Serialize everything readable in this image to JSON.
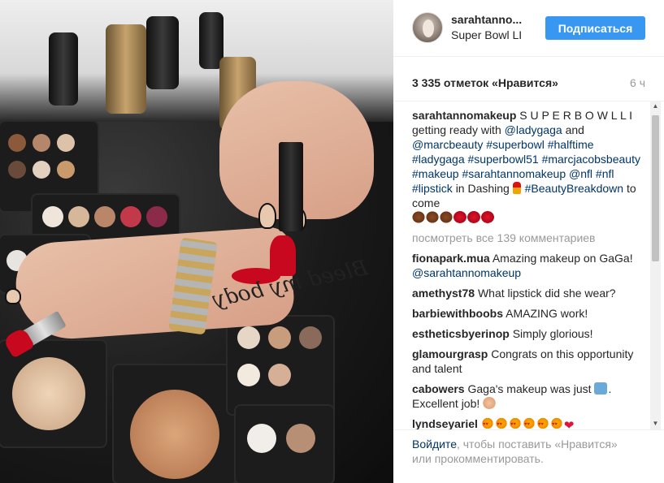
{
  "post": {
    "username": "sarahtanno...",
    "location": "Super Bowl LI",
    "follow_label": "Подписаться",
    "likes": "3 335 отметок «Нравится»",
    "time_ago": "6 ч"
  },
  "caption": {
    "user": "sarahtannomakeup",
    "text_1": "S U P E R B O W L L I getting ready with",
    "mention_1": "@ladygaga",
    "text_2": "and",
    "tags": "@marcbeauty #superbowl #halftime #ladygaga #superbowl51 #marcjacobsbeauty #makeup #sarahtannomakeup @nfl #nfl #lipstick",
    "text_3": "in Dashing",
    "tag_beauty": "#BeautyBreakdown",
    "text_4": "to come"
  },
  "view_all": "посмотреть все 139 комментариев",
  "comments": [
    {
      "user": "fionapark.mua",
      "text": "Amazing makeup on GaGa!",
      "mention": "@sarahtannomakeup"
    },
    {
      "user": "amethyst78",
      "text": "What lipstick did she wear?"
    },
    {
      "user": "barbiewithboobs",
      "text": "AMAZING work!"
    },
    {
      "user": "estheticsbyerinop",
      "text": "Simply glorious!"
    },
    {
      "user": "glamourgrasp",
      "text": "Congrats on this opportunity and talent"
    },
    {
      "user": "cabowers",
      "text_a": "Gaga's makeup was just",
      "text_b": ". Excellent job!"
    },
    {
      "user": "lyndseyariel",
      "text": ""
    }
  ],
  "footer": {
    "login": "Войдите",
    "rest": ", чтобы поставить «Нравится» или прокомментировать."
  },
  "icons": {
    "scroll_up": "▲",
    "scroll_down": "▼",
    "red_heart": "❤"
  },
  "colors": {
    "follow_button": "#3897f0",
    "link": "#003569",
    "muted": "#999999"
  }
}
